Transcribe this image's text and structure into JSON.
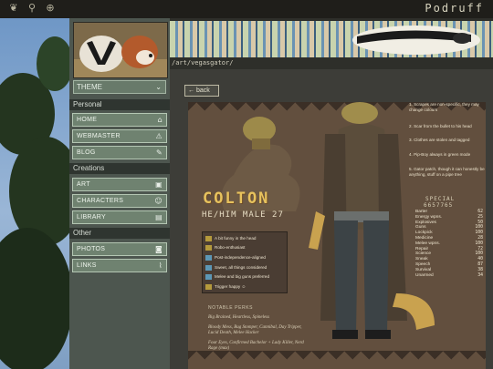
{
  "topbar": {
    "icons": [
      "leaf-icon",
      "tooth-icon",
      "target-icon"
    ],
    "brand": "Podruff"
  },
  "sidebar": {
    "theme_label": "THEME",
    "sections": [
      {
        "title": "Personal",
        "items": [
          {
            "label": "HOME",
            "icon": "home-icon"
          },
          {
            "label": "WEBMASTER",
            "icon": "warning-icon"
          },
          {
            "label": "BLOG",
            "icon": "pencil-icon"
          }
        ]
      },
      {
        "title": "Creations",
        "items": [
          {
            "label": "ART",
            "icon": "image-icon"
          },
          {
            "label": "CHARACTERS",
            "icon": "portrait-icon"
          },
          {
            "label": "LIBRARY",
            "icon": "book-icon"
          }
        ]
      },
      {
        "title": "Other",
        "items": [
          {
            "label": "PHOTOS",
            "icon": "camera-icon"
          },
          {
            "label": "LINKS",
            "icon": "paperclip-icon"
          }
        ]
      }
    ]
  },
  "path": "/art/vegasgator/",
  "back_label": "← back",
  "ref": {
    "name": "COLTON",
    "pronouns": "HE/HIM  MALE  27",
    "traits": [
      {
        "text": "A bit funny in the head",
        "color": "#b59a3c"
      },
      {
        "text": "Robo-enthusiast",
        "color": "#b59a3c"
      },
      {
        "text": "Post-independence-aligned",
        "color": "#5c97b5"
      },
      {
        "text": "Sweet, all things considered",
        "color": "#5c97b5"
      },
      {
        "text": "Melee and big guns preferred",
        "color": "#5c97b5"
      },
      {
        "text": "Trigger happy ☺",
        "color": "#b59a3c"
      }
    ],
    "perks_title": "NOTABLE PERKS",
    "perks": [
      "Big Brained, Heartless, Spineless",
      "Bloody Mess, Bug Stomper, Cannibal, Day Tripper, Lucid Death, Melee Hacker",
      "Four Eyes, Confirmed Bachelor + Lady Killer, Nerd Rage (max)"
    ],
    "notes": [
      "1. Scrapes are non-specific, they may change colours",
      "2. Scar from the bullet to his head",
      "3. Clothes are stolen and tagged",
      "4. Pip-Boy always in green mode",
      "5. Gator patch, though it can honestly be anything, stuff on a pipe tree"
    ],
    "special_title": "SPECIAL",
    "special_code": "6657765",
    "stats": [
      {
        "name": "Barter",
        "value": "62"
      },
      {
        "name": "Energy wpns.",
        "value": "25"
      },
      {
        "name": "Explosives",
        "value": "50"
      },
      {
        "name": "Guns",
        "value": "100"
      },
      {
        "name": "Lockpick",
        "value": "100"
      },
      {
        "name": "Medicine",
        "value": "28"
      },
      {
        "name": "Melee wpns.",
        "value": "100"
      },
      {
        "name": "Repair",
        "value": "72"
      },
      {
        "name": "Science",
        "value": "100"
      },
      {
        "name": "Sneak",
        "value": "40"
      },
      {
        "name": "Speech",
        "value": "87"
      },
      {
        "name": "Survival",
        "value": "38"
      },
      {
        "name": "Unarmed",
        "value": "34"
      }
    ]
  }
}
